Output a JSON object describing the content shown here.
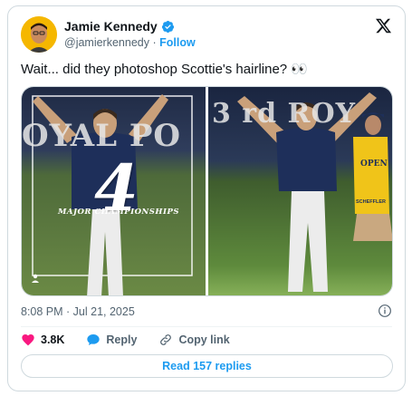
{
  "author": {
    "name": "Jamie Kennedy",
    "handle": "@jamierkennedy",
    "separator": "·",
    "follow_label": "Follow"
  },
  "tweet": {
    "text": "Wait... did they photoshop Scottie's hairline? 👀",
    "timestamp": "8:08 PM · Jul 21, 2025"
  },
  "media": {
    "image1": {
      "banner": "OYAL PO",
      "number": "4",
      "caption": "MAJOR CHAMPIONSHIPS"
    },
    "image2": {
      "banner": "3 rd ROY",
      "bib_open": "OPEN",
      "bib_name": "SCHEFFLER"
    }
  },
  "actions": {
    "likes": "3.8K",
    "reply_label": "Reply",
    "copy_link_label": "Copy link"
  },
  "read_replies_label": "Read 157 replies",
  "colors": {
    "accent": "#1d9bf0",
    "heart": "#f91880",
    "border": "#cfd9de",
    "muted": "#536471"
  }
}
